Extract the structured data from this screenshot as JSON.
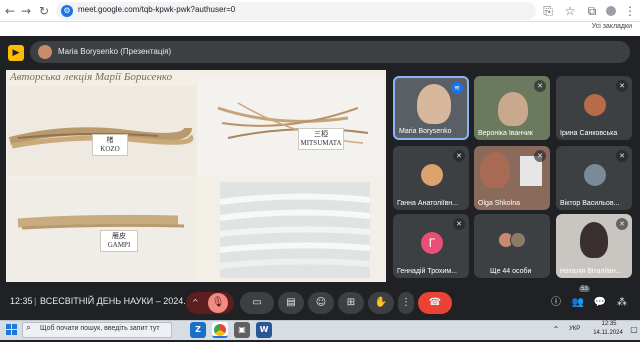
{
  "browser": {
    "url": "meet.google.com/tqb-kpwk-pwk?authuser=0",
    "bookmarks_all": "Усі закладки"
  },
  "presenter": {
    "name": "Maria Borysenko (Презентація)"
  },
  "slide": {
    "title": "Авторська лекція Марії Борисенко",
    "labels": [
      "KOZO",
      "MITSUMATA",
      "GAMPI"
    ],
    "kanji": [
      "楮",
      "三椏",
      "雁皮"
    ]
  },
  "participants": [
    {
      "name": "Maria Borysenko",
      "state": "speaking"
    },
    {
      "name": "Вероніка Іванчик",
      "state": "muted"
    },
    {
      "name": "Ірина Санковська",
      "state": "muted"
    },
    {
      "name": "Ганна Анатоліївн...",
      "state": "muted"
    },
    {
      "name": "Olga Shkolna",
      "state": "muted"
    },
    {
      "name": "Віктор Васильов...",
      "state": "muted"
    },
    {
      "name": "Геннадій Трохим...",
      "state": "muted",
      "initial": "Г"
    },
    {
      "name": "Ще 44 особи",
      "state": "none"
    },
    {
      "name": "Наталія Віталіївн...",
      "state": "muted"
    }
  ],
  "meeting": {
    "time": "12:35",
    "separator": "|",
    "title": "ВСЕСВІТНІЙ ДЕНЬ НАУКИ – 2024. Ф...",
    "people_count": "53"
  },
  "taskbar": {
    "search_placeholder": "Щоб почати пошук, введіть запит тут",
    "language": "УКР",
    "time": "12:35",
    "date": "14.11.2024"
  },
  "colors": {
    "meet_bg": "#202124",
    "tile_bg": "#3c4043",
    "end_call": "#ea4335",
    "mic_off": "#5c1e1e",
    "accent": "#1a73e8"
  }
}
